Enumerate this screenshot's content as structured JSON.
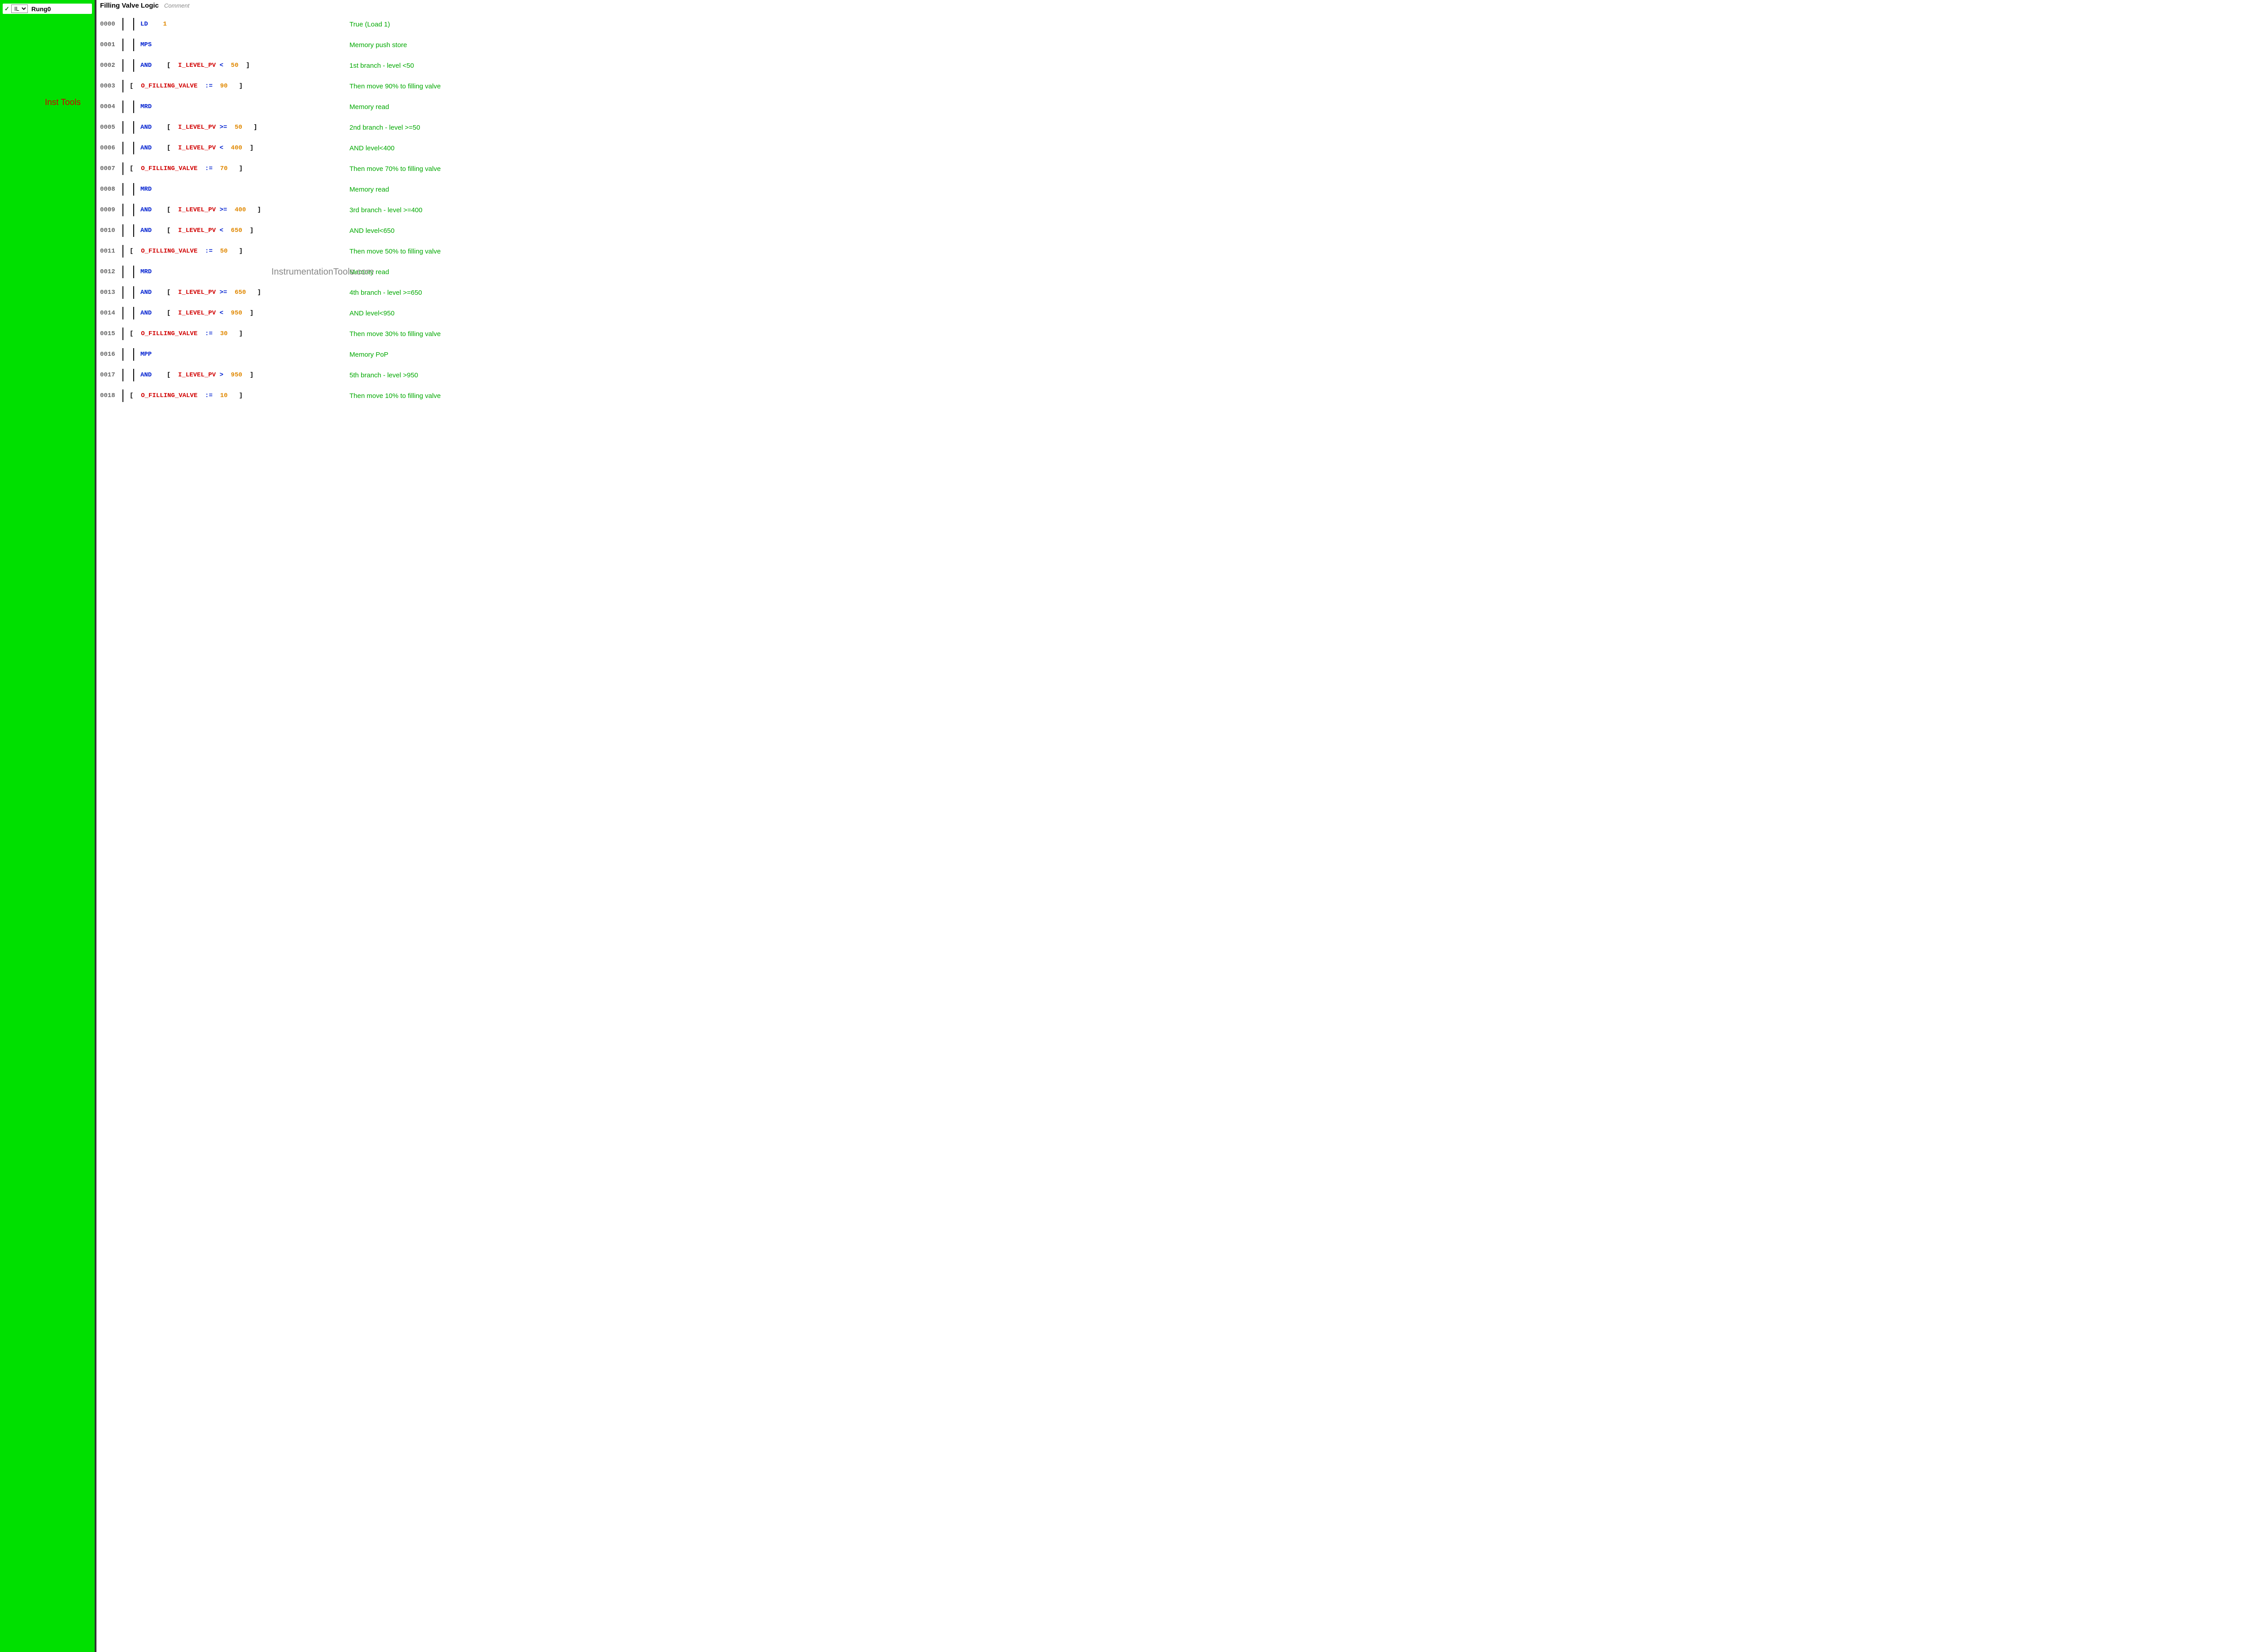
{
  "sidebar": {
    "check": "✓",
    "lang": "IL",
    "rung": "Rung0",
    "watermark": "Inst Tools"
  },
  "header": {
    "title": "Filling Valve Logic",
    "comment": "Comment"
  },
  "watermark_main": "InstrumentationTools.com",
  "rows": [
    {
      "num": "0000",
      "indent": true,
      "tokens": [
        {
          "t": "LD",
          "c": "blue",
          "sp": 4
        },
        {
          "t": "1",
          "c": "orange",
          "sp": 0
        }
      ],
      "comment": "True (Load 1)"
    },
    {
      "num": "0001",
      "indent": true,
      "tokens": [
        {
          "t": "MPS",
          "c": "blue",
          "sp": 0
        }
      ],
      "comment": "Memory push store"
    },
    {
      "num": "0002",
      "indent": true,
      "tokens": [
        {
          "t": "AND",
          "c": "blue",
          "sp": 4
        },
        {
          "t": "[",
          "c": "black",
          "sp": 2
        },
        {
          "t": "I_LEVEL_PV",
          "c": "red",
          "sp": 1
        },
        {
          "t": "<",
          "c": "blue",
          "sp": 2
        },
        {
          "t": "50",
          "c": "orange",
          "sp": 2
        },
        {
          "t": "]",
          "c": "black",
          "sp": 0
        }
      ],
      "comment": "1st branch - level <50"
    },
    {
      "num": "0003",
      "indent": false,
      "tokens": [
        {
          "t": "[",
          "c": "black",
          "sp": 2
        },
        {
          "t": "O_FILLING_VALVE",
          "c": "red",
          "sp": 2
        },
        {
          "t": ":=",
          "c": "blue",
          "sp": 2
        },
        {
          "t": "90",
          "c": "orange",
          "sp": 3
        },
        {
          "t": "]",
          "c": "black",
          "sp": 0
        }
      ],
      "comment": "Then move 90% to filling valve"
    },
    {
      "num": "0004",
      "indent": true,
      "tokens": [
        {
          "t": "MRD",
          "c": "blue",
          "sp": 0
        }
      ],
      "comment": "Memory read"
    },
    {
      "num": "0005",
      "indent": true,
      "tokens": [
        {
          "t": "AND",
          "c": "blue",
          "sp": 4
        },
        {
          "t": "[",
          "c": "black",
          "sp": 2
        },
        {
          "t": "I_LEVEL_PV",
          "c": "red",
          "sp": 1
        },
        {
          "t": ">=",
          "c": "blue",
          "sp": 2
        },
        {
          "t": "50",
          "c": "orange",
          "sp": 3
        },
        {
          "t": "]",
          "c": "black",
          "sp": 0
        }
      ],
      "comment": "2nd branch - level >=50"
    },
    {
      "num": "0006",
      "indent": true,
      "tokens": [
        {
          "t": "AND",
          "c": "blue",
          "sp": 4
        },
        {
          "t": "[",
          "c": "black",
          "sp": 2
        },
        {
          "t": "I_LEVEL_PV",
          "c": "red",
          "sp": 1
        },
        {
          "t": "<",
          "c": "blue",
          "sp": 2
        },
        {
          "t": "400",
          "c": "orange",
          "sp": 2
        },
        {
          "t": "]",
          "c": "black",
          "sp": 0
        }
      ],
      "comment": "AND level<400"
    },
    {
      "num": "0007",
      "indent": false,
      "tokens": [
        {
          "t": "[",
          "c": "black",
          "sp": 2
        },
        {
          "t": "O_FILLING_VALVE",
          "c": "red",
          "sp": 2
        },
        {
          "t": ":=",
          "c": "blue",
          "sp": 2
        },
        {
          "t": "70",
          "c": "orange",
          "sp": 3
        },
        {
          "t": "]",
          "c": "black",
          "sp": 0
        }
      ],
      "comment": "Then move 70% to filling valve"
    },
    {
      "num": "0008",
      "indent": true,
      "tokens": [
        {
          "t": "MRD",
          "c": "blue",
          "sp": 0
        }
      ],
      "comment": "Memory read"
    },
    {
      "num": "0009",
      "indent": true,
      "tokens": [
        {
          "t": "AND",
          "c": "blue",
          "sp": 4
        },
        {
          "t": "[",
          "c": "black",
          "sp": 2
        },
        {
          "t": "I_LEVEL_PV",
          "c": "red",
          "sp": 1
        },
        {
          "t": ">=",
          "c": "blue",
          "sp": 2
        },
        {
          "t": "400",
          "c": "orange",
          "sp": 3
        },
        {
          "t": "]",
          "c": "black",
          "sp": 0
        }
      ],
      "comment": "3rd branch - level >=400"
    },
    {
      "num": "0010",
      "indent": true,
      "tokens": [
        {
          "t": "AND",
          "c": "blue",
          "sp": 4
        },
        {
          "t": "[",
          "c": "black",
          "sp": 2
        },
        {
          "t": "I_LEVEL_PV",
          "c": "red",
          "sp": 1
        },
        {
          "t": "<",
          "c": "blue",
          "sp": 2
        },
        {
          "t": "650",
          "c": "orange",
          "sp": 2
        },
        {
          "t": "]",
          "c": "black",
          "sp": 0
        }
      ],
      "comment": "AND level<650"
    },
    {
      "num": "0011",
      "indent": false,
      "tokens": [
        {
          "t": "[",
          "c": "black",
          "sp": 2
        },
        {
          "t": "O_FILLING_VALVE",
          "c": "red",
          "sp": 2
        },
        {
          "t": ":=",
          "c": "blue",
          "sp": 2
        },
        {
          "t": "50",
          "c": "orange",
          "sp": 3
        },
        {
          "t": "]",
          "c": "black",
          "sp": 0
        }
      ],
      "comment": "Then move 50% to filling valve"
    },
    {
      "num": "0012",
      "indent": true,
      "tokens": [
        {
          "t": "MRD",
          "c": "blue",
          "sp": 0
        }
      ],
      "comment": "Memory read"
    },
    {
      "num": "0013",
      "indent": true,
      "tokens": [
        {
          "t": "AND",
          "c": "blue",
          "sp": 4
        },
        {
          "t": "[",
          "c": "black",
          "sp": 2
        },
        {
          "t": "I_LEVEL_PV",
          "c": "red",
          "sp": 1
        },
        {
          "t": ">=",
          "c": "blue",
          "sp": 2
        },
        {
          "t": "650",
          "c": "orange",
          "sp": 3
        },
        {
          "t": "]",
          "c": "black",
          "sp": 0
        }
      ],
      "comment": "4th branch - level >=650"
    },
    {
      "num": "0014",
      "indent": true,
      "tokens": [
        {
          "t": "AND",
          "c": "blue",
          "sp": 4
        },
        {
          "t": "[",
          "c": "black",
          "sp": 2
        },
        {
          "t": "I_LEVEL_PV",
          "c": "red",
          "sp": 1
        },
        {
          "t": "<",
          "c": "blue",
          "sp": 2
        },
        {
          "t": "950",
          "c": "orange",
          "sp": 2
        },
        {
          "t": "]",
          "c": "black",
          "sp": 0
        }
      ],
      "comment": "AND level<950"
    },
    {
      "num": "0015",
      "indent": false,
      "tokens": [
        {
          "t": "[",
          "c": "black",
          "sp": 2
        },
        {
          "t": "O_FILLING_VALVE",
          "c": "red",
          "sp": 2
        },
        {
          "t": ":=",
          "c": "blue",
          "sp": 2
        },
        {
          "t": "30",
          "c": "orange",
          "sp": 3
        },
        {
          "t": "]",
          "c": "black",
          "sp": 0
        }
      ],
      "comment": "Then move 30% to filling valve"
    },
    {
      "num": "0016",
      "indent": true,
      "tokens": [
        {
          "t": "MPP",
          "c": "blue",
          "sp": 0
        }
      ],
      "comment": "Memory PoP"
    },
    {
      "num": "0017",
      "indent": true,
      "tokens": [
        {
          "t": "AND",
          "c": "blue",
          "sp": 4
        },
        {
          "t": "[",
          "c": "black",
          "sp": 2
        },
        {
          "t": "I_LEVEL_PV",
          "c": "red",
          "sp": 1
        },
        {
          "t": ">",
          "c": "blue",
          "sp": 2
        },
        {
          "t": "950",
          "c": "orange",
          "sp": 2
        },
        {
          "t": "]",
          "c": "black",
          "sp": 0
        }
      ],
      "comment": "5th branch - level >950"
    },
    {
      "num": "0018",
      "indent": false,
      "tokens": [
        {
          "t": "[",
          "c": "black",
          "sp": 2
        },
        {
          "t": "O_FILLING_VALVE",
          "c": "red",
          "sp": 2
        },
        {
          "t": ":=",
          "c": "blue",
          "sp": 2
        },
        {
          "t": "10",
          "c": "orange",
          "sp": 3
        },
        {
          "t": "]",
          "c": "black",
          "sp": 0
        }
      ],
      "comment": "Then move 10% to filling valve"
    }
  ]
}
